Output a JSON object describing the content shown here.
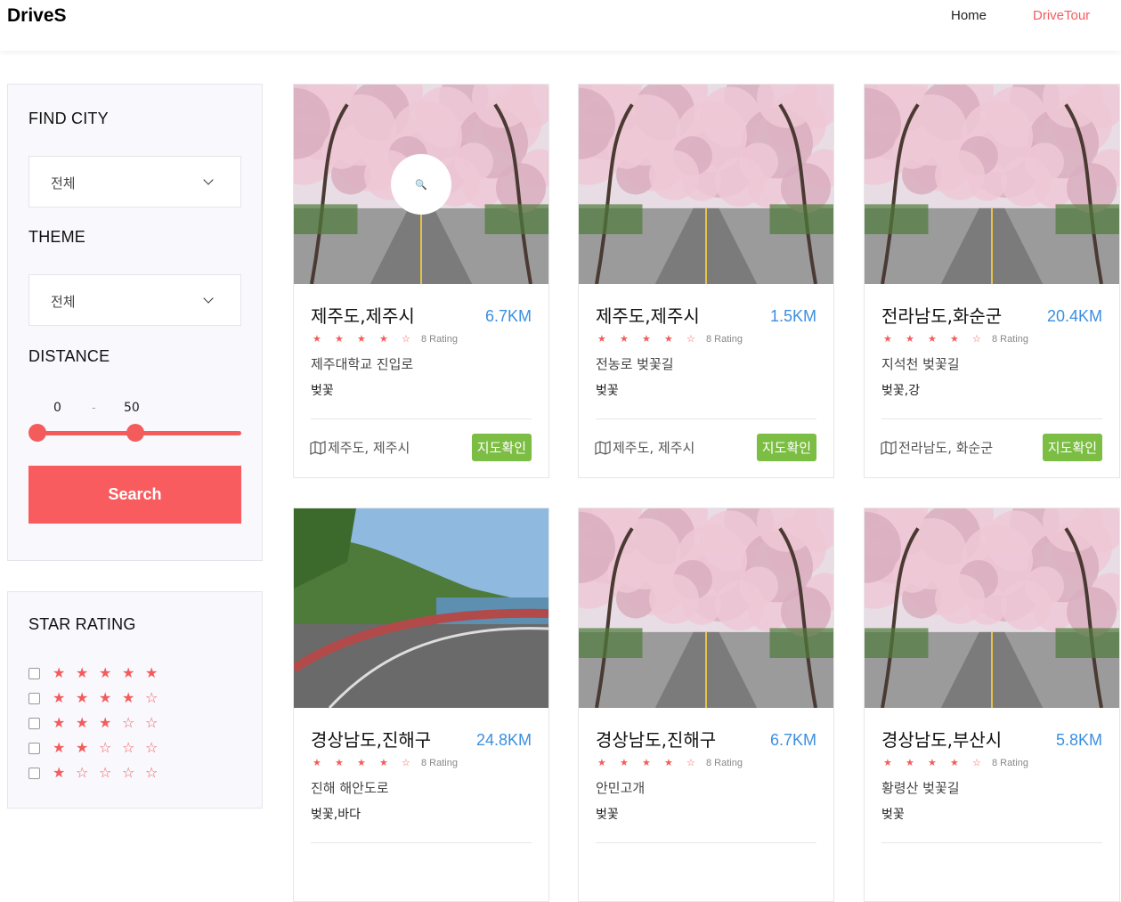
{
  "header": {
    "brand": "DriveS",
    "nav": [
      "Home",
      "DriveTour"
    ]
  },
  "filters": {
    "city_heading": "FIND CITY",
    "city_value": "전체",
    "theme_heading": "THEME",
    "theme_value": "전체",
    "distance_heading": "DISTANCE",
    "distance_min": "0",
    "distance_sep": "-",
    "distance_max": "50",
    "search_label": "Search"
  },
  "star_rating": {
    "heading": "STAR RATING",
    "options": [
      5,
      4,
      3,
      2,
      1
    ]
  },
  "cards": [
    {
      "city": "제주도,제주시",
      "distance": "6.7KM",
      "stars": 4,
      "rating": "8 Rating",
      "road": "제주대학교 진입로",
      "tags": "벚꽃",
      "location": "제주도, 제주시",
      "map_btn": "지도확인"
    },
    {
      "city": "제주도,제주시",
      "distance": "1.5KM",
      "stars": 4,
      "rating": "8 Rating",
      "road": "전농로 벚꽃길",
      "tags": "벚꽃",
      "location": "제주도, 제주시",
      "map_btn": "지도확인"
    },
    {
      "city": "전라남도,화순군",
      "distance": "20.4KM",
      "stars": 4,
      "rating": "8 Rating",
      "road": "지석천 벚꽃길",
      "tags": "벚꽃,강",
      "location": "전라남도, 화순군",
      "map_btn": "지도확인"
    },
    {
      "city": "경상남도,진해구",
      "distance": "24.8KM",
      "stars": 4,
      "rating": "8 Rating",
      "road": "진해 해안도로",
      "tags": "벚꽃,바다",
      "location": "",
      "map_btn": ""
    },
    {
      "city": "경상남도,진해구",
      "distance": "6.7KM",
      "stars": 4,
      "rating": "8 Rating",
      "road": "안민고개",
      "tags": "벚꽃",
      "location": "",
      "map_btn": ""
    },
    {
      "city": "경상남도,부산시",
      "distance": "5.8KM",
      "stars": 4,
      "rating": "8 Rating",
      "road": "황령산 벚꽃길",
      "tags": "벚꽃",
      "location": "",
      "map_btn": ""
    }
  ],
  "colors": {
    "accent": "#f45c5c",
    "distance": "#3b8fe0",
    "map_button": "#7cbd43"
  }
}
